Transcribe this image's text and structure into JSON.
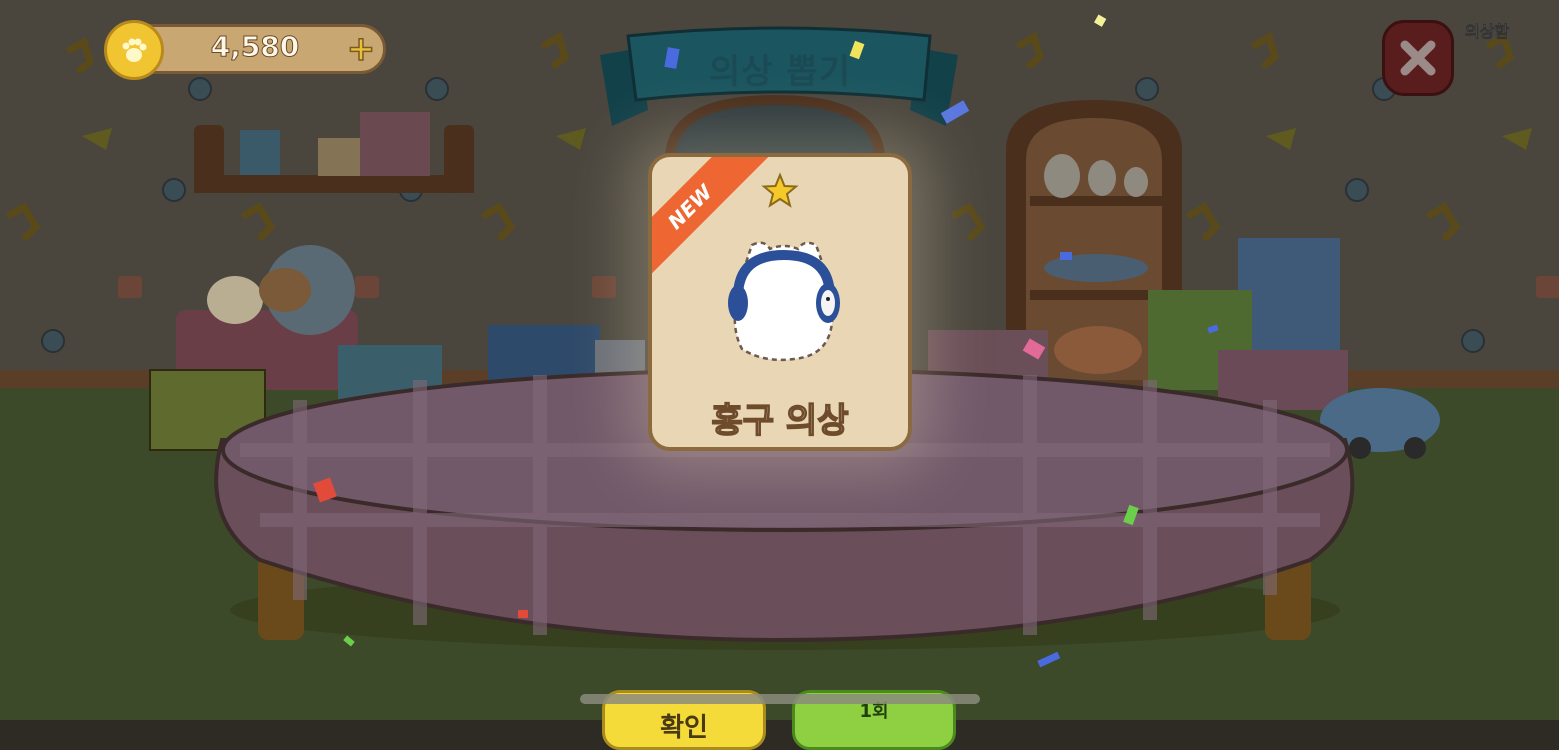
{
  "currency": {
    "icon": "paw-coin-icon",
    "amount": "4,580",
    "add_icon": "plus-icon"
  },
  "title": "의상 뽑기",
  "top_right": {
    "wardrobe_label": "의상함",
    "close_icon": "close-icon"
  },
  "reward": {
    "badge": "NEW",
    "rarity_icon": "star-icon",
    "item_icon": "headphones-costume-icon",
    "item_name": "홍구 의상"
  },
  "buttons": {
    "confirm_label": "확인",
    "again_label": "1회"
  },
  "colors": {
    "ribbon": "#ee6631",
    "coin": "#f0c531",
    "banner": "#1b5660",
    "confirm_button": "#f5db3a",
    "again_button": "#8fd043"
  }
}
